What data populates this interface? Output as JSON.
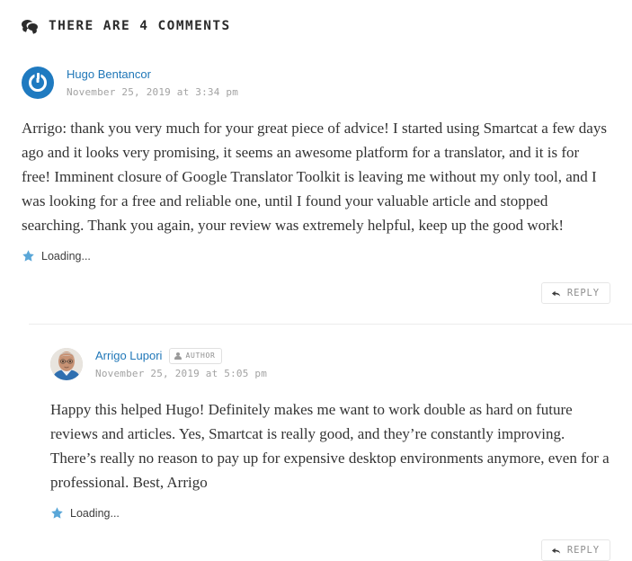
{
  "header": {
    "icon": "comments-icon",
    "title": "THERE ARE 4 COMMENTS",
    "count": 4
  },
  "colors": {
    "link": "#2077b8",
    "avatar_brand": "#1f7ac0",
    "star": "#5aa7d8",
    "date_text": "#a2a2a2",
    "body_text": "#333333",
    "border": "#e6e6e6"
  },
  "comments": [
    {
      "id": "comment-1",
      "level": 1,
      "author": "Hugo Bentancor",
      "is_author_badge": false,
      "badge_label": "",
      "avatar_type": "logo-mark",
      "date": "November 25, 2019 at 3:34 pm",
      "body": "Arrigo: thank you very much for your great piece of advice! I started using Smartcat a few days ago and it looks very promising, it seems an awesome platform for a translator, and it is for free! Imminent closure of Google Translator Toolkit is leaving me without my only tool, and I was looking for a free and reliable one, until I found your valuable article and stopped searching. Thank you again, your review was extremely helpful, keep up the good work!",
      "loading_label": "Loading...",
      "reply_label": "REPLY"
    },
    {
      "id": "comment-2",
      "level": 2,
      "author": "Arrigo Lupori",
      "is_author_badge": true,
      "badge_label": "AUTHOR",
      "avatar_type": "photo",
      "date": "November 25, 2019 at 5:05 pm",
      "body": "Happy this helped Hugo! Definitely makes me want to work double as hard on future reviews and articles. Yes, Smartcat is really good, and they’re constantly improving. There’s really no reason to pay up for expensive desktop environments anymore, even for a professional. Best, Arrigo",
      "loading_label": "Loading...",
      "reply_label": "REPLY"
    }
  ]
}
